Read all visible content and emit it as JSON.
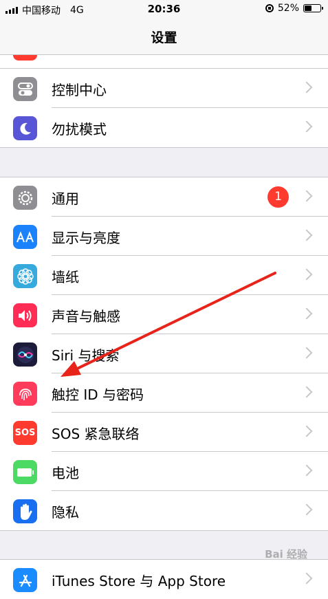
{
  "status_bar": {
    "carrier": "中国移动",
    "network": "4G",
    "time": "20:36",
    "battery_percent": "52%",
    "battery_level": 0.52
  },
  "nav": {
    "title": "设置"
  },
  "groups": [
    {
      "items": [
        {
          "label": "控制中心",
          "icon": "toggle-switches-icon",
          "color": "#8e8e93"
        },
        {
          "label": "勿扰模式",
          "icon": "moon-icon",
          "color": "#5856d6"
        }
      ]
    },
    {
      "items": [
        {
          "label": "通用",
          "icon": "gear-icon",
          "color": "#8e8e93",
          "badge": "1"
        },
        {
          "label": "显示与亮度",
          "icon": "aa-text-icon",
          "color": "#1a82fb"
        },
        {
          "label": "墙纸",
          "icon": "flower-icon",
          "color": "#36aadc"
        },
        {
          "label": "声音与触感",
          "icon": "speaker-icon",
          "color": "#ff2d55"
        },
        {
          "label": "Siri 与搜索",
          "icon": "siri-icon",
          "color": "#1c1c3a"
        },
        {
          "label": "触控 ID 与密码",
          "icon": "fingerprint-icon",
          "color": "#ff3b5c"
        },
        {
          "label": "SOS 紧急联络",
          "icon": "sos-icon",
          "color": "#ff3b30",
          "icon_text": "SOS"
        },
        {
          "label": "电池",
          "icon": "battery-icon",
          "color": "#4cd964"
        },
        {
          "label": "隐私",
          "icon": "hand-icon",
          "color": "#1a6ff0"
        }
      ]
    },
    {
      "items": [
        {
          "label": "iTunes Store 与 App Store",
          "icon": "app-store-icon",
          "color": "#1a8cff"
        }
      ]
    }
  ],
  "annotation": {
    "color": "#e8231a"
  },
  "watermark": "Bai 经验"
}
